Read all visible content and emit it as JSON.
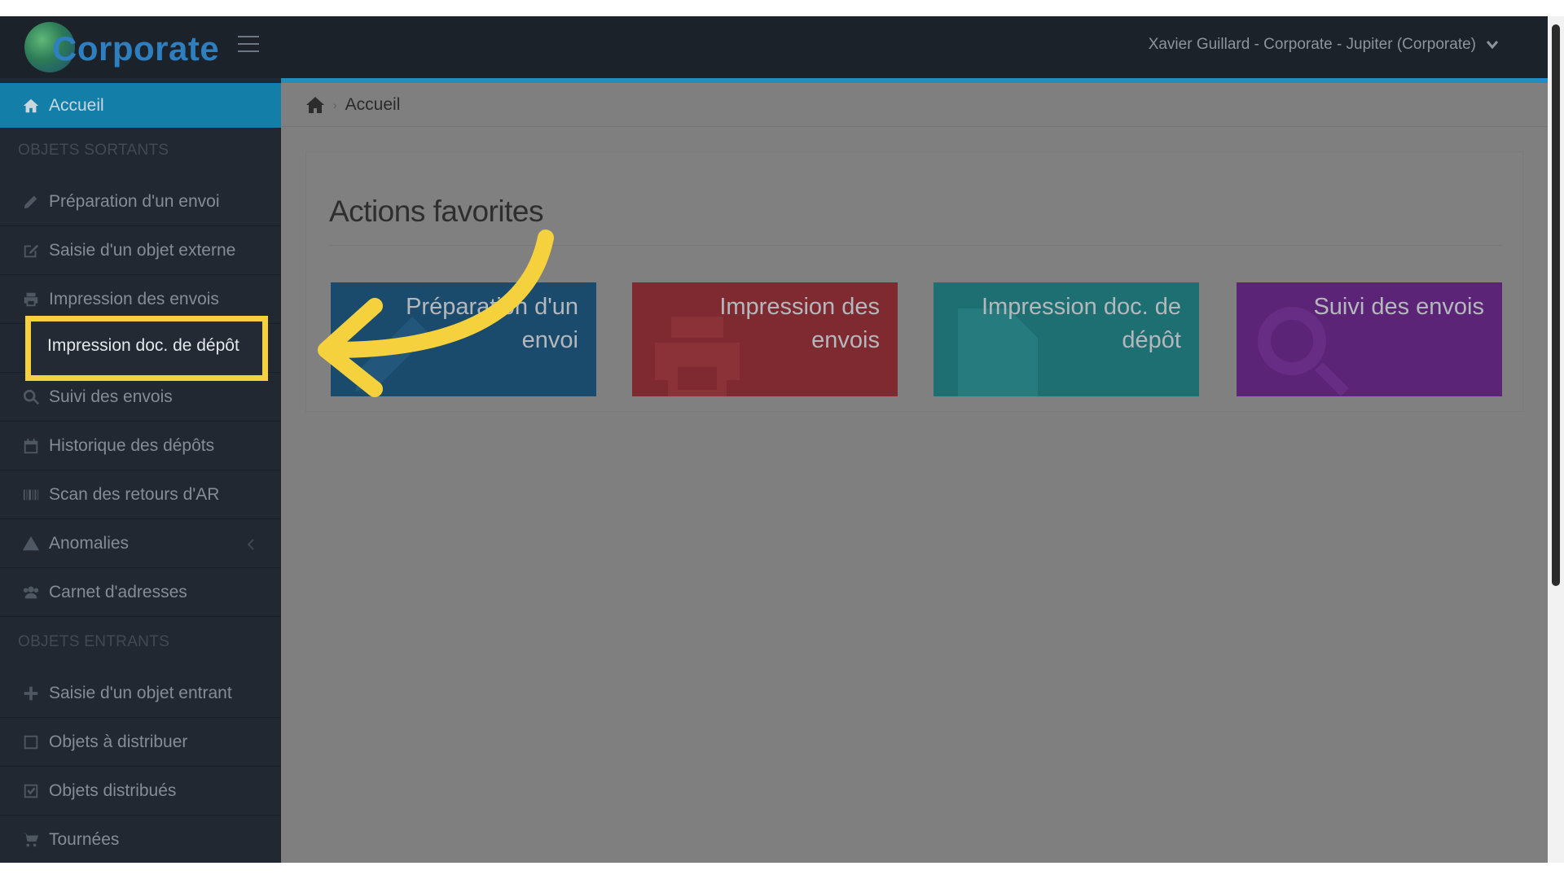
{
  "brand": {
    "logo_text": "Corporate"
  },
  "header": {
    "user_label": "Xavier Guillard - Corporate - Jupiter (Corporate)"
  },
  "sidebar": {
    "home": {
      "label": "Accueil",
      "icon": "home-icon"
    },
    "sections": [
      {
        "title": "OBJETS SORTANTS",
        "items": [
          {
            "label": "Préparation d'un envoi",
            "icon": "pencil-icon"
          },
          {
            "label": "Saisie d'un objet externe",
            "icon": "external-edit-icon"
          },
          {
            "label": "Impression des envois",
            "icon": "printer-icon"
          },
          {
            "label": "Impression doc. de dépôt",
            "icon": "document-icon"
          },
          {
            "label": "Suivi des envois",
            "icon": "search-icon"
          },
          {
            "label": "Historique des dépôts",
            "icon": "calendar-icon"
          },
          {
            "label": "Scan des retours d'AR",
            "icon": "barcode-icon"
          },
          {
            "label": "Anomalies",
            "icon": "warning-icon"
          },
          {
            "label": "Carnet d'adresses",
            "icon": "users-icon"
          }
        ]
      },
      {
        "title": "OBJETS ENTRANTS",
        "items": [
          {
            "label": "Saisie d'un objet entrant",
            "icon": "plus-icon"
          },
          {
            "label": "Objets à distribuer",
            "icon": "checkbox-empty-icon"
          },
          {
            "label": "Objets distribués",
            "icon": "checkbox-checked-icon"
          },
          {
            "label": "Tournées",
            "icon": "cart-icon"
          }
        ]
      }
    ]
  },
  "breadcrumb": {
    "current": "Accueil"
  },
  "favorites": {
    "title": "Actions favorites",
    "tiles": [
      {
        "label": "Préparation d'un envoi",
        "icon": "pencil-icon",
        "color": "#1b4b6c"
      },
      {
        "label": "Impression des envois",
        "icon": "printer-icon",
        "color": "#7e2a30"
      },
      {
        "label": "Impression doc. de dépôt",
        "icon": "document-icon",
        "color": "#1d6f71"
      },
      {
        "label": "Suivi des envois",
        "icon": "search-icon",
        "color": "#5b2476"
      }
    ]
  },
  "annotation": {
    "color": "#f6d13e"
  }
}
